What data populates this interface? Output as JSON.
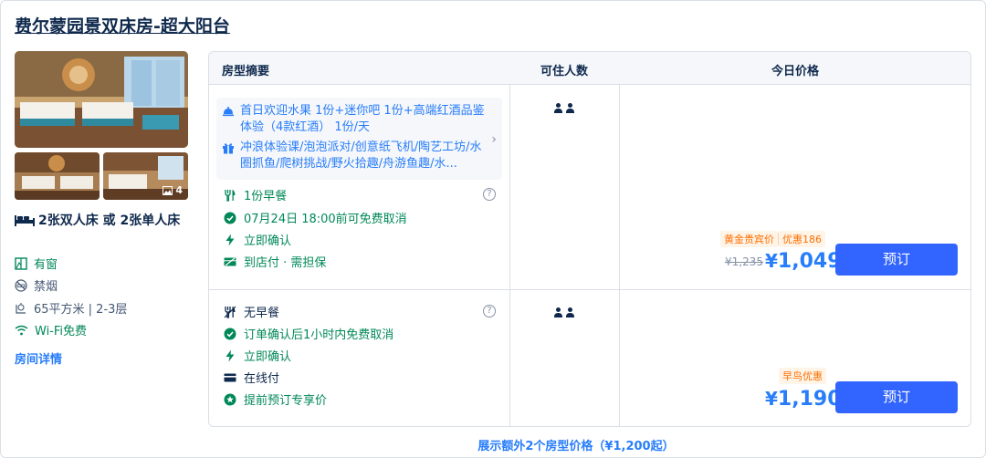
{
  "room": {
    "title": "费尔蒙园景双床房-超大阳台",
    "photo_count": "4",
    "bed": "2张双人床 或 2张单人床",
    "features": [
      {
        "icon": "window-icon",
        "text": "有窗",
        "green": true
      },
      {
        "icon": "no-smoking-icon",
        "text": "禁烟",
        "green": false
      },
      {
        "icon": "area-icon",
        "text": "65平方米 | 2-3层",
        "green": false
      },
      {
        "icon": "wifi-icon",
        "text": "Wi-Fi免费",
        "green": true
      }
    ],
    "detail_link": "房间详情"
  },
  "table": {
    "headers": {
      "summary": "房型摘要",
      "guests": "可住人数",
      "price": "今日价格"
    }
  },
  "rates": [
    {
      "promos": [
        {
          "icon": "welcome-bell-icon",
          "text": "首日欢迎水果 1份+迷你吧 1份+高端红酒品鉴体验（4款红酒） 1份/天"
        },
        {
          "icon": "gift-icon",
          "text": "冲浪体验课/泡泡派对/创意纸飞机/陶艺工坊/水圈抓鱼/爬树挑战/野火拾趣/舟游鱼趣/水..."
        }
      ],
      "items": [
        {
          "icon": "fork-knife-icon",
          "text": "1份早餐",
          "green": true,
          "help": true
        },
        {
          "icon": "check-circle-icon",
          "text": "07月24日 18:00前可免费取消",
          "green": true
        },
        {
          "icon": "lightning-icon",
          "text": "立即确认",
          "green": true
        },
        {
          "icon": "pay-at-hotel-icon",
          "text": "到店付 · 需担保",
          "green": true
        }
      ],
      "badges": [
        "黄金贵宾价",
        "优惠186"
      ],
      "original_price": "¥1,235",
      "currency": "¥",
      "price": "1,049",
      "book_label": "预订"
    },
    {
      "items": [
        {
          "icon": "no-breakfast-icon",
          "text": "无早餐",
          "green": false,
          "help": true
        },
        {
          "icon": "check-circle-icon",
          "text": "订单确认后1小时内免费取消",
          "green": true
        },
        {
          "icon": "lightning-icon",
          "text": "立即确认",
          "green": true
        },
        {
          "icon": "card-icon",
          "text": "在线付",
          "green": false
        },
        {
          "icon": "star-circle-icon",
          "text": "提前预订专享价",
          "green": true
        }
      ],
      "badges": [
        "早鸟优惠"
      ],
      "currency": "¥",
      "price": "1,190",
      "book_label": "预订"
    }
  ],
  "more_link": "展示额外2个房型价格（¥1,200起）",
  "colors": {
    "accent": "#287dfa",
    "button": "#3264ff",
    "green": "#008858",
    "orange": "#ff6f00"
  }
}
